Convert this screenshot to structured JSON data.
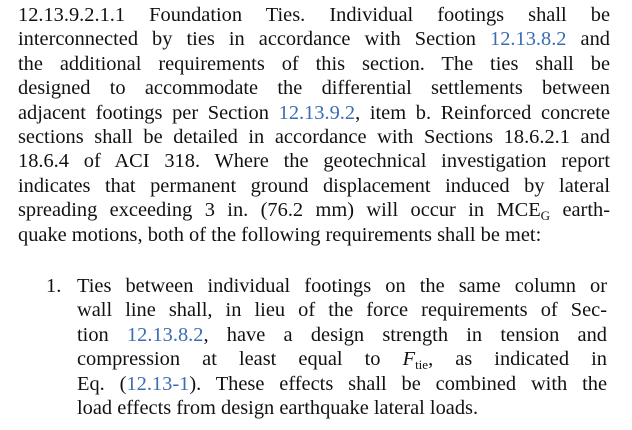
{
  "section": {
    "number": "12.13.9.2.1.1",
    "heading": "Foundation Ties.",
    "lines": {
      "l1_rest": "Individual footings shall be",
      "l2_a": "interconnected by ties in accordance with Section",
      "l2_link": "12.13.8.2",
      "l2_b": "and",
      "l3": "the additional requirements of this section. The ties shall be",
      "l4": "designed to accommodate the differential settlements between",
      "l5_a": "adjacent footings per Section",
      "l5_link": "12.13.9.2",
      "l5_b": ", item b. Reinforced concrete",
      "l6": "sections shall be detailed in accordance with Sections 18.6.2.1 and",
      "l7": "18.6.4 of ACI 318. Where the geotechnical investigation report",
      "l8": "indicates that permanent ground displacement induced by lateral",
      "l9_a": "spreading exceeding 3 in. (76.2 mm) will occur in MCE",
      "l9_sub": "G",
      "l9_b": "earth-",
      "l10": "quake motions, both of the following requirements shall be met:"
    }
  },
  "list": {
    "items": [
      {
        "number": "1.",
        "lines": {
          "l1": "Ties between individual footings on the same column or",
          "l2": "wall line shall, in lieu of the force requirements of Sec-",
          "l3_a": "tion",
          "l3_link": "12.13.8.2",
          "l3_b": ", have a design strength in tension and",
          "l4_a": "compression at least equal to",
          "l4_var": "F",
          "l4_sub": "tie",
          "l4_b": ", as indicated in",
          "l5_a": "Eq. (",
          "l5_link": "12.13-1",
          "l5_b": "). These effects shall be combined with the",
          "l6": "load effects from design earthquake lateral loads."
        }
      }
    ]
  },
  "colors": {
    "text": "#111111",
    "link": "#3b6db3",
    "background": "#ffffff"
  }
}
